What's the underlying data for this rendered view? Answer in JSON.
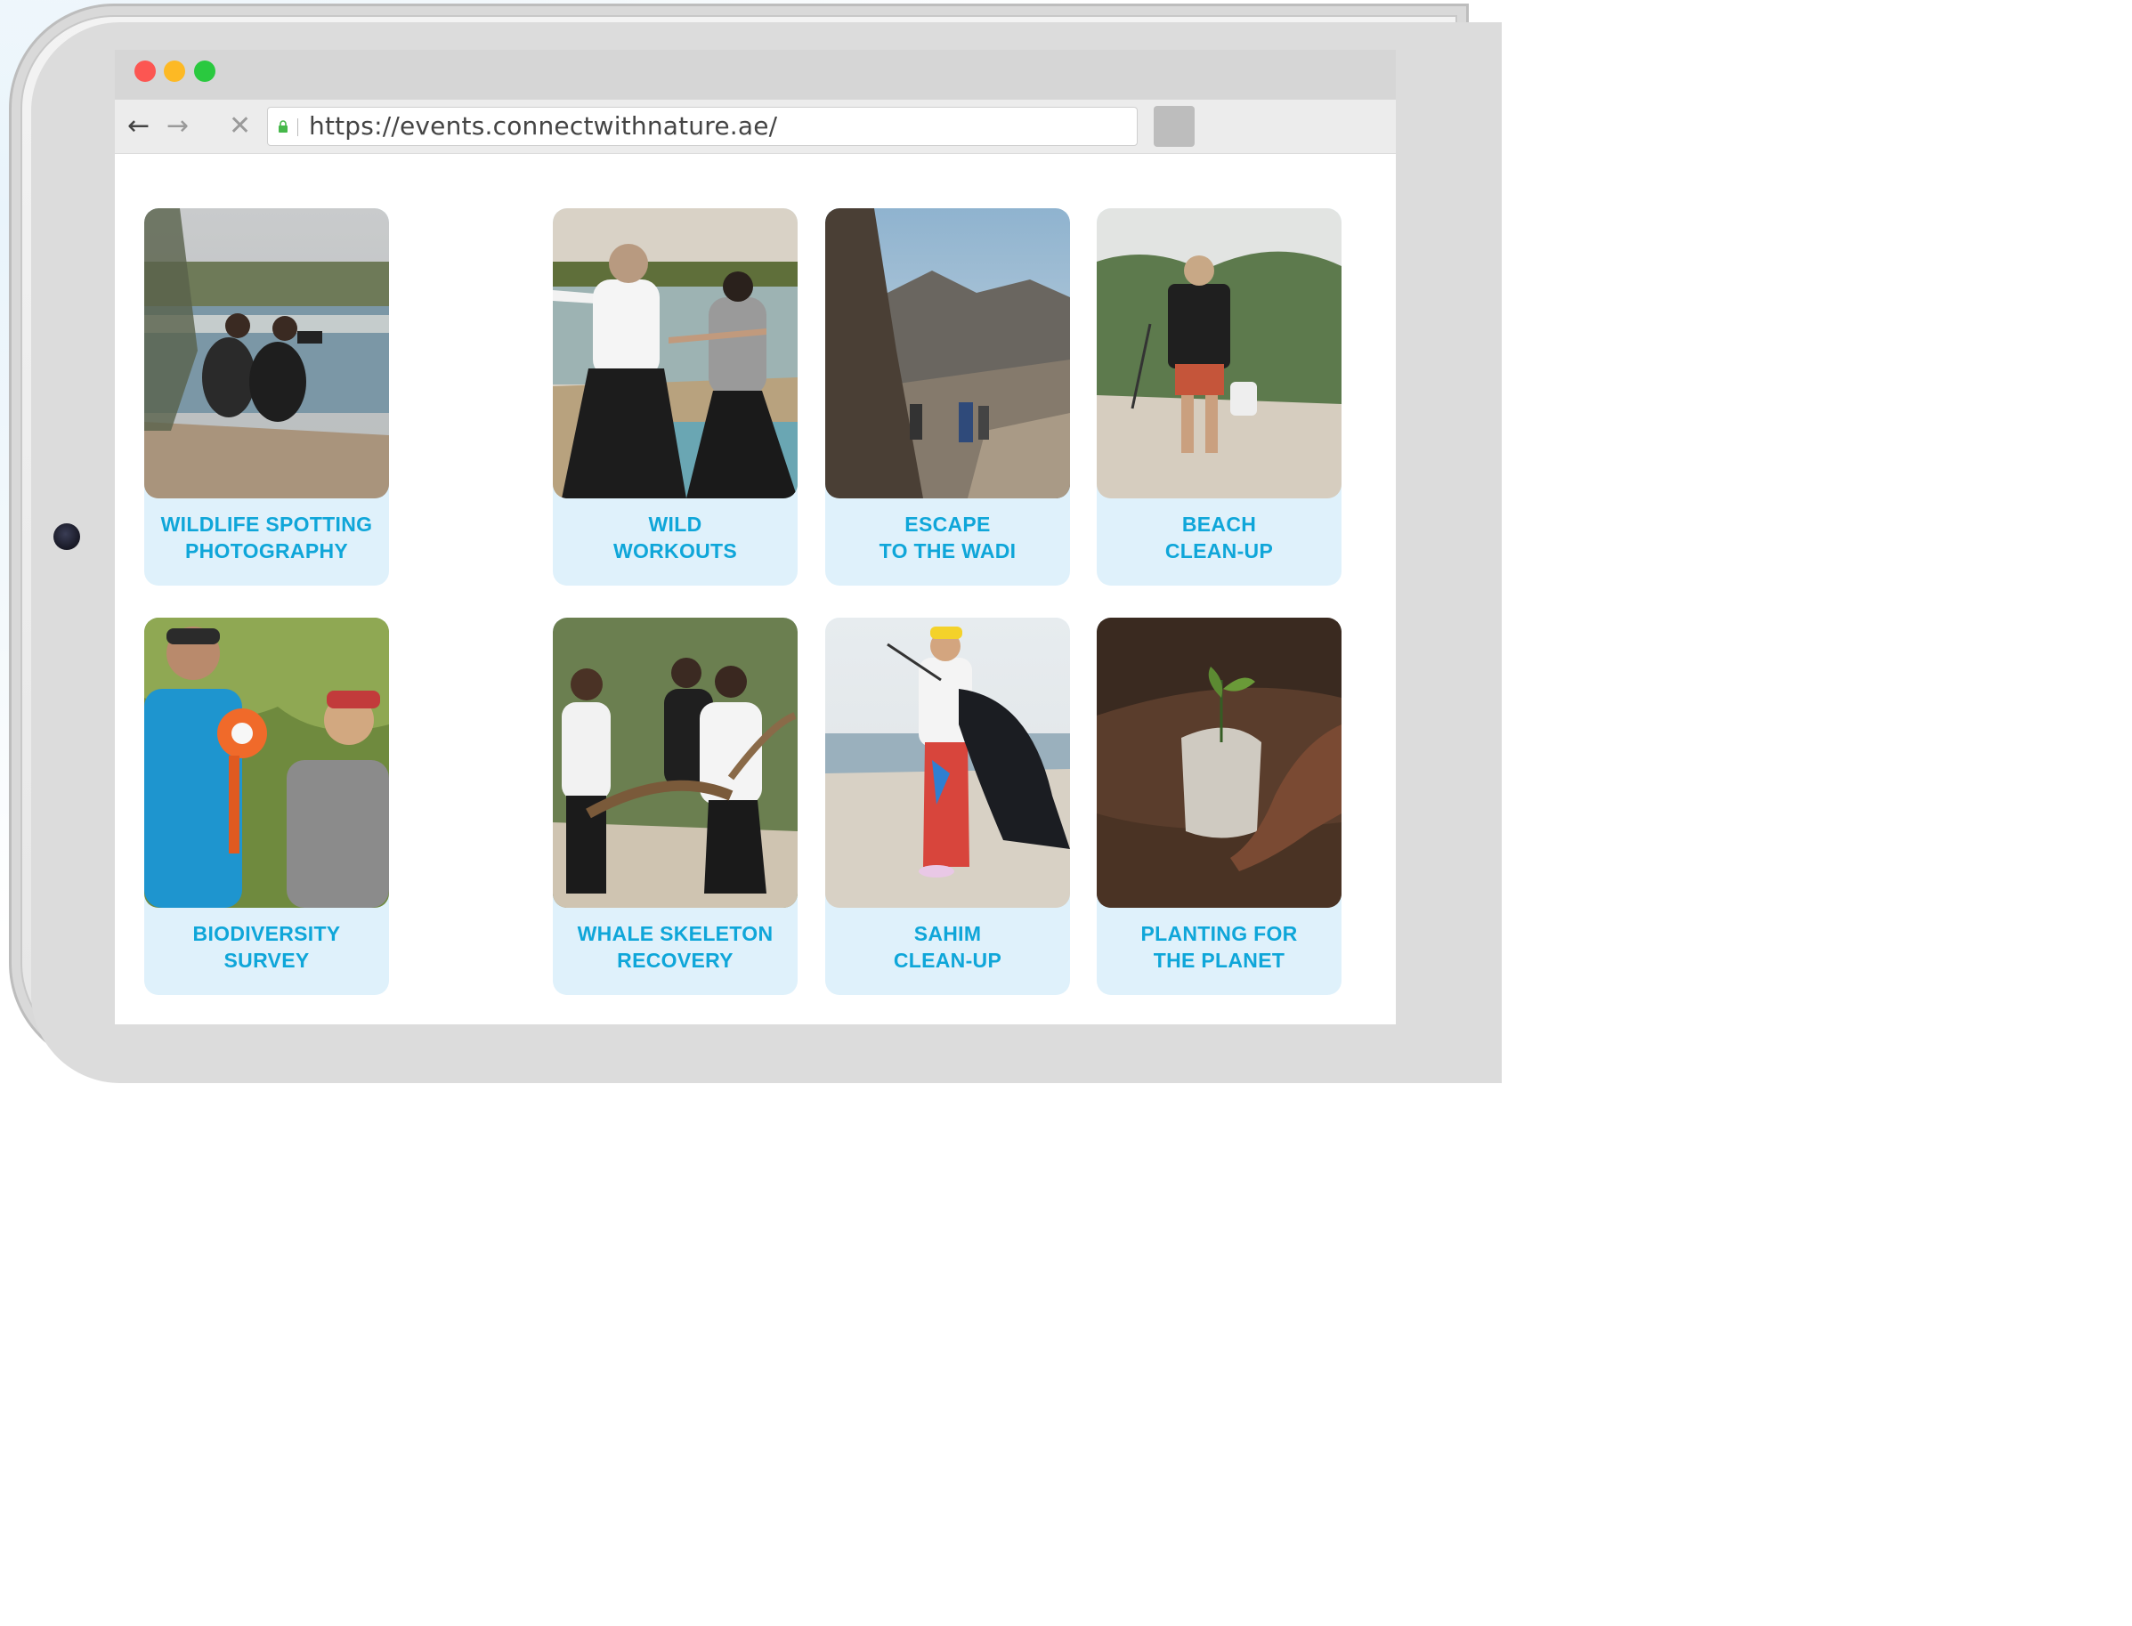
{
  "browser": {
    "url": "https://events.connectwithnature.ae/",
    "icons": {
      "back": "arrow-left-icon",
      "forward": "arrow-right-icon",
      "stop": "close-icon",
      "lock": "lock-icon"
    }
  },
  "colors": {
    "accent": "#0fa6d9",
    "card_bg": "#dff1fb"
  },
  "events": [
    {
      "line1": "WILDLIFE SPOTTING",
      "line2": "PHOTOGRAPHY"
    },
    {
      "line1": "WILD",
      "line2": "WORKOUTS"
    },
    {
      "line1": "ESCAPE",
      "line2": "TO THE WADI"
    },
    {
      "line1": "BEACH",
      "line2": "CLEAN-UP"
    },
    {
      "line1": "BIODIVERSITY",
      "line2": "SURVEY"
    },
    {
      "line1": "WHALE SKELETON",
      "line2": "RECOVERY"
    },
    {
      "line1": "SAHIM",
      "line2": "CLEAN-UP"
    },
    {
      "line1": "PLANTING FOR",
      "line2": "THE PLANET"
    }
  ]
}
